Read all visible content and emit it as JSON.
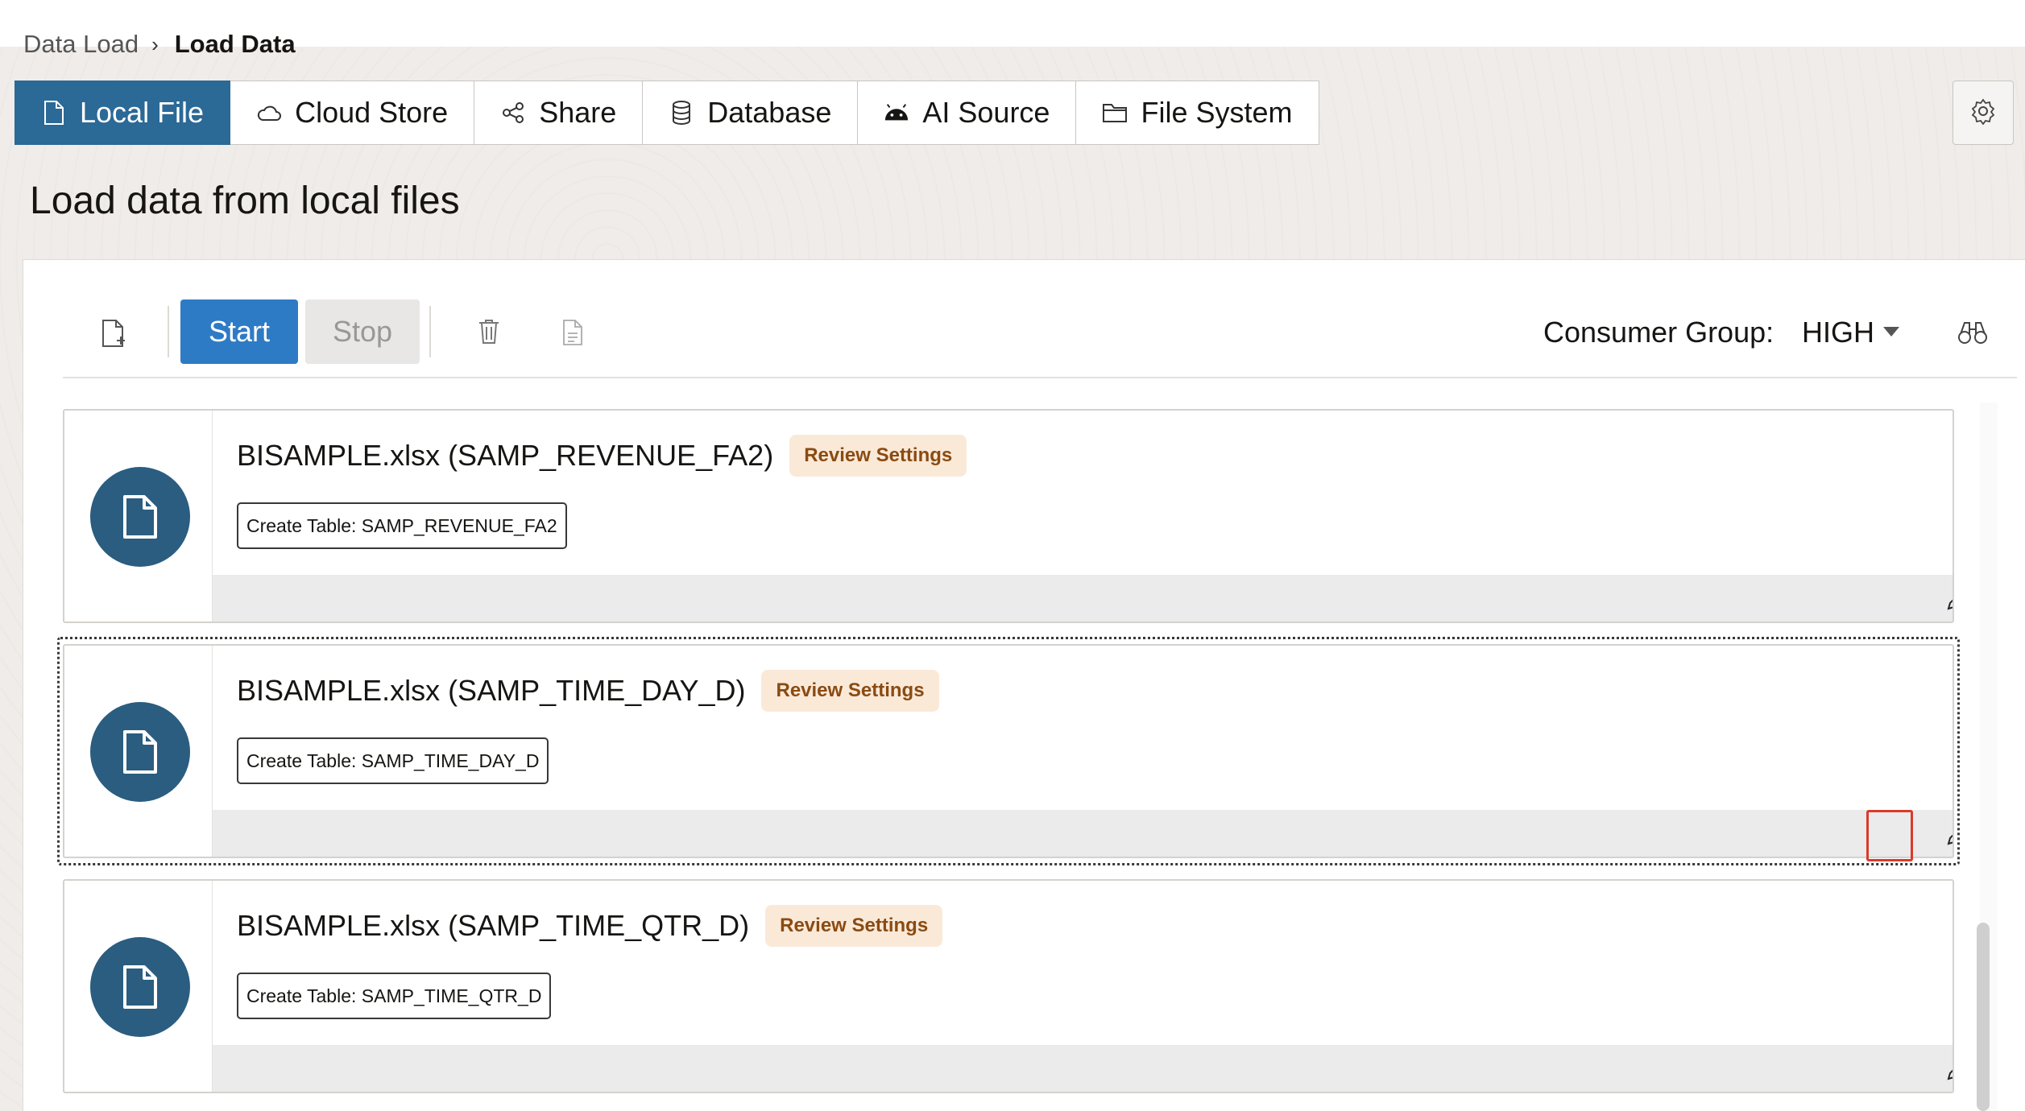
{
  "breadcrumb": {
    "parent": "Data Load",
    "current": "Load Data"
  },
  "tabs": [
    {
      "label": "Local File",
      "icon": "file-icon",
      "active": true
    },
    {
      "label": "Cloud Store",
      "icon": "cloud-icon",
      "active": false
    },
    {
      "label": "Share",
      "icon": "share-icon",
      "active": false
    },
    {
      "label": "Database",
      "icon": "database-icon",
      "active": false
    },
    {
      "label": "AI Source",
      "icon": "android-icon",
      "active": false
    },
    {
      "label": "File System",
      "icon": "folder-icon",
      "active": false
    }
  ],
  "page_title": "Load data from local files",
  "toolbar": {
    "start_label": "Start",
    "stop_label": "Stop",
    "consumer_group_label": "Consumer Group:",
    "consumer_group_value": "HIGH"
  },
  "colors": {
    "accent": "#2b6996",
    "start_button": "#2e7bc5",
    "file_circle": "#2a5d80",
    "badge_bg": "#fbe9d8",
    "badge_text": "#8a4b12",
    "highlight": "#d93b2b"
  },
  "cards": [
    {
      "title": "BISAMPLE.xlsx (SAMP_REVENUE_FA2)",
      "badge": "Review Settings",
      "action": "Create Table: SAMP_REVENUE_FA2"
    },
    {
      "title": "BISAMPLE.xlsx (SAMP_TIME_DAY_D)",
      "badge": "Review Settings",
      "action": "Create Table: SAMP_TIME_DAY_D",
      "focused": true
    },
    {
      "title": "BISAMPLE.xlsx (SAMP_TIME_QTR_D)",
      "badge": "Review Settings",
      "action": "Create Table: SAMP_TIME_QTR_D"
    }
  ]
}
